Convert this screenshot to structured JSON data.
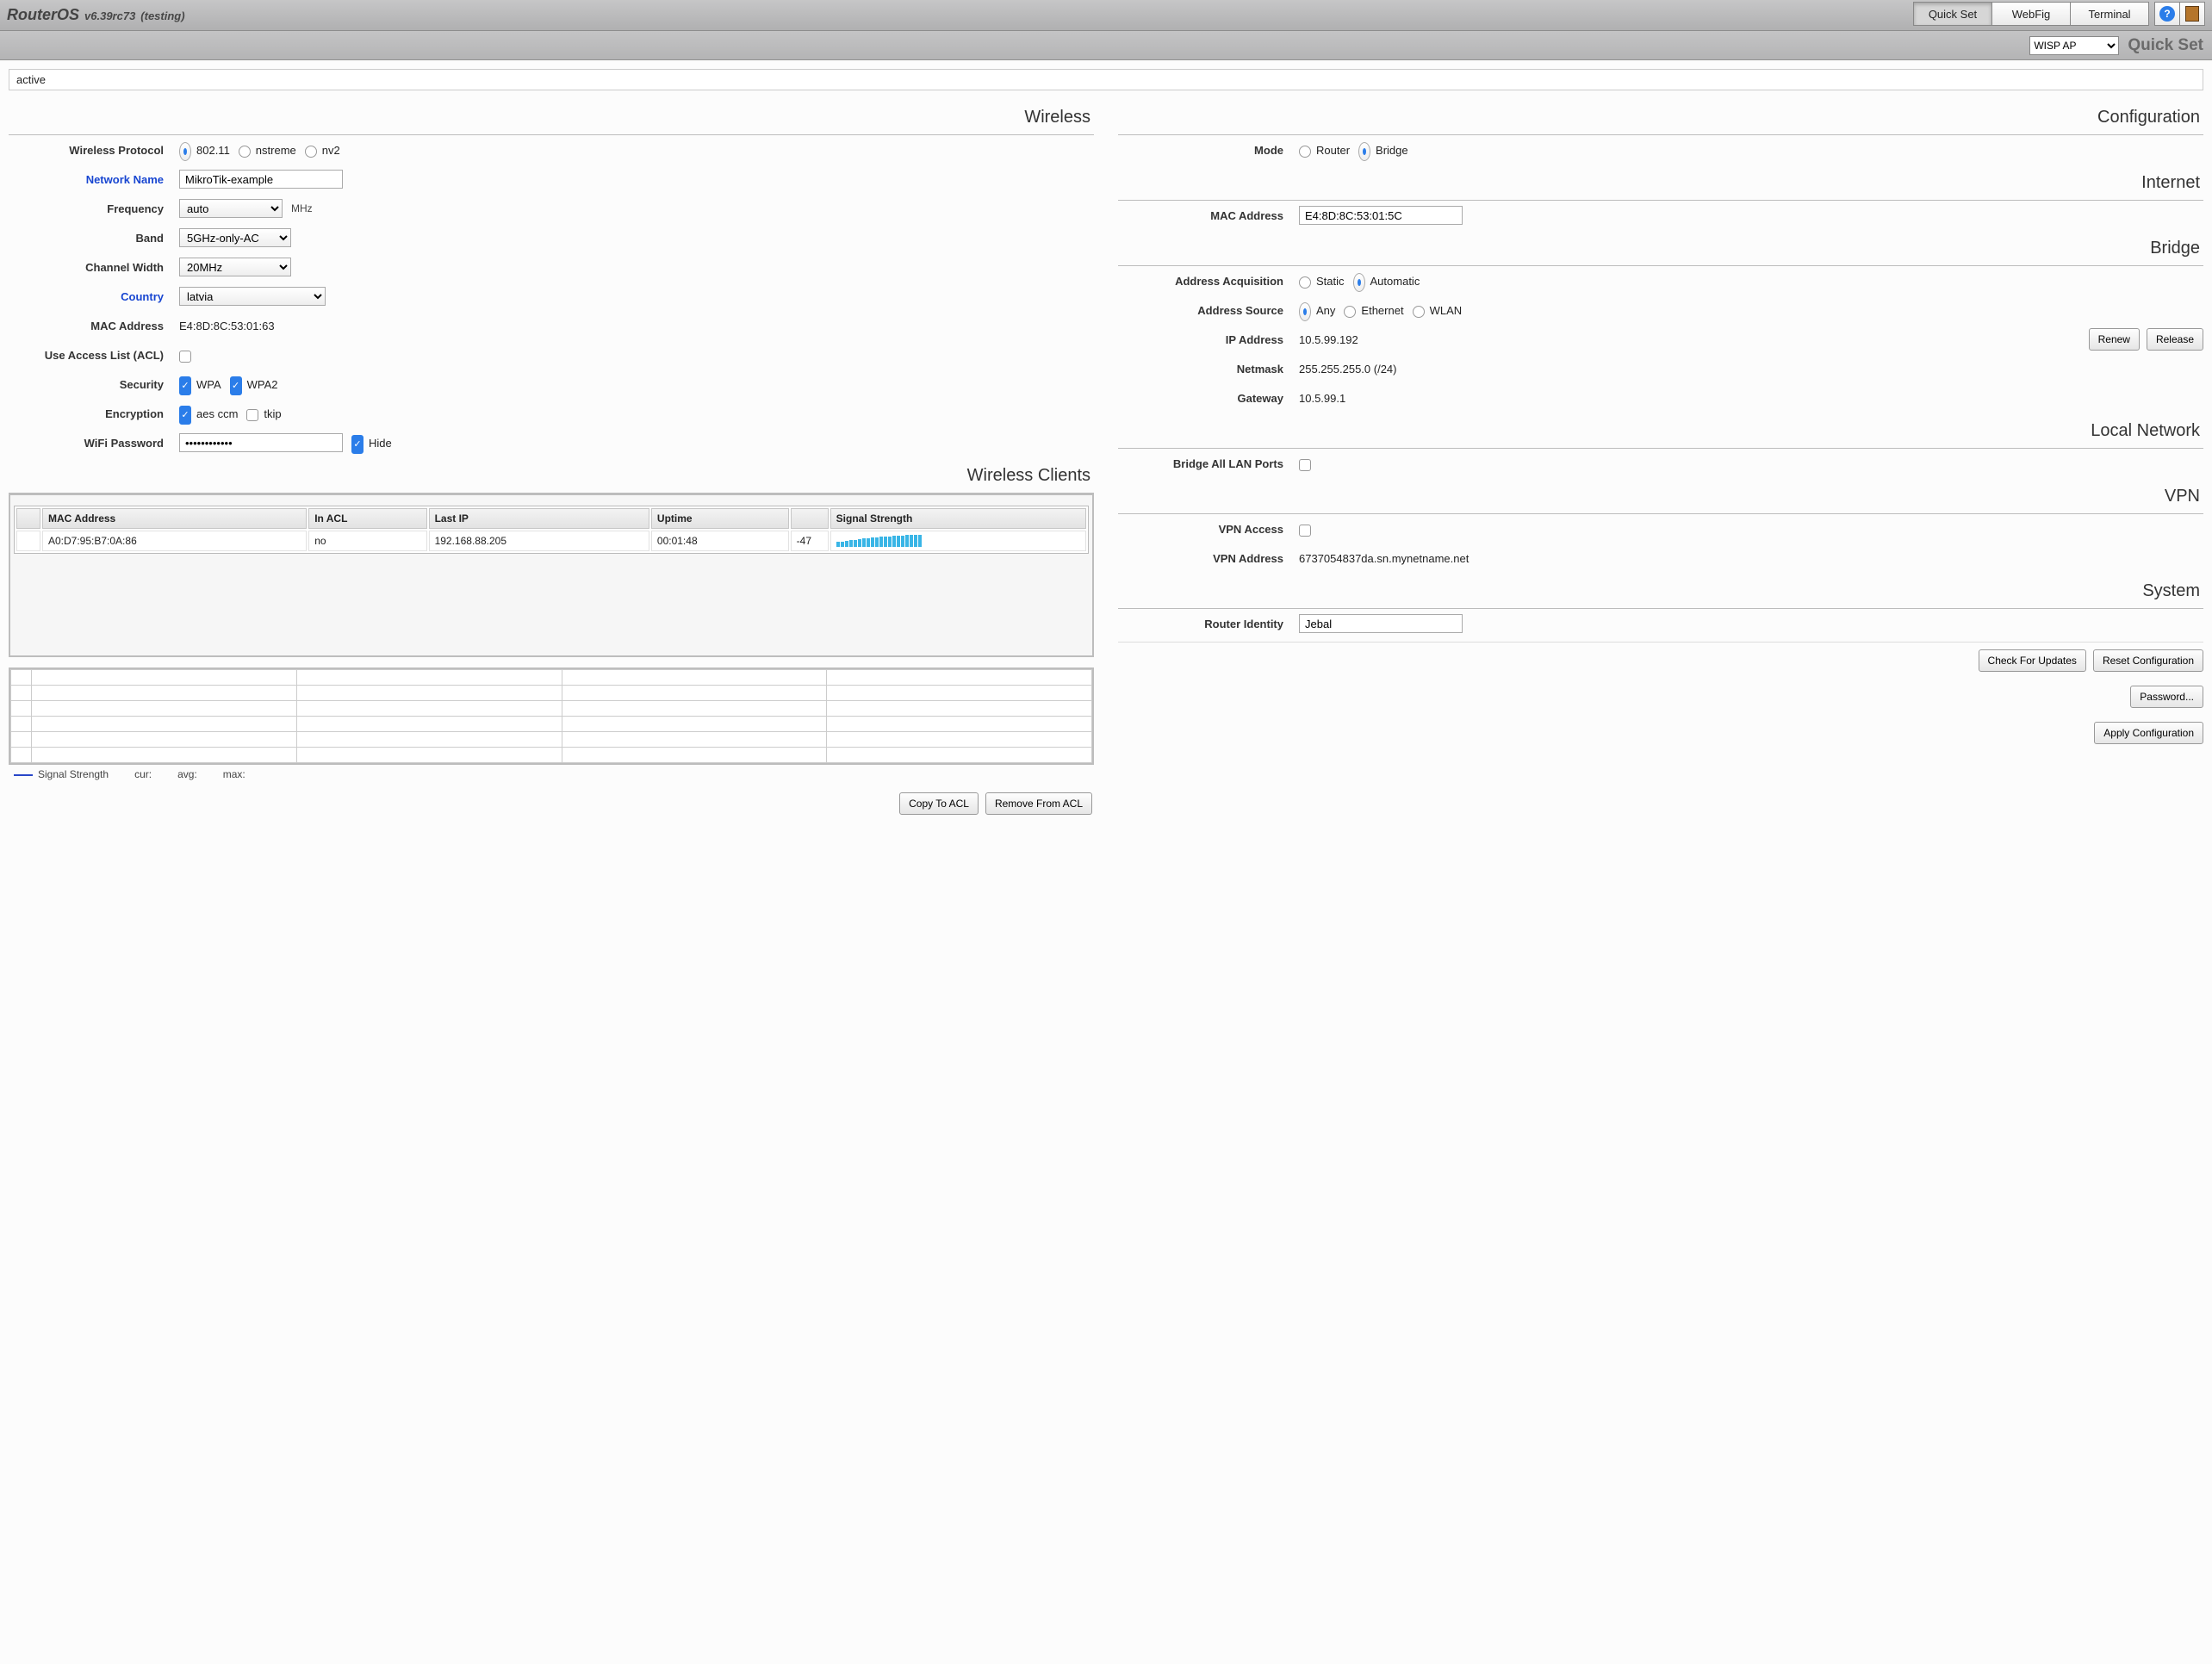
{
  "header": {
    "brand": "RouterOS",
    "version": "v6.39rc73",
    "testing": "(testing)",
    "tabs": {
      "quickset": "Quick Set",
      "webfig": "WebFig",
      "terminal": "Terminal"
    }
  },
  "subheader": {
    "mode_select": "WISP AP",
    "title": "Quick Set"
  },
  "status": "active",
  "wireless": {
    "title": "Wireless",
    "protocol_label": "Wireless Protocol",
    "protocol_opts": {
      "a": "802.11",
      "b": "nstreme",
      "c": "nv2"
    },
    "network_name_label": "Network Name",
    "network_name": "MikroTik-example",
    "frequency_label": "Frequency",
    "frequency": "auto",
    "frequency_unit": "MHz",
    "band_label": "Band",
    "band": "5GHz-only-AC",
    "chwidth_label": "Channel Width",
    "chwidth": "20MHz",
    "country_label": "Country",
    "country": "latvia",
    "mac_label": "MAC Address",
    "mac": "E4:8D:8C:53:01:63",
    "acl_label": "Use Access List (ACL)",
    "sec_label": "Security",
    "sec_wpa": "WPA",
    "sec_wpa2": "WPA2",
    "enc_label": "Encryption",
    "enc_aes": "aes ccm",
    "enc_tkip": "tkip",
    "pwd_label": "WiFi Password",
    "pwd_value": "••••••••••••",
    "pwd_hide": "Hide"
  },
  "clients": {
    "title": "Wireless Clients",
    "cols": {
      "mac": "MAC Address",
      "acl": "In ACL",
      "ip": "Last IP",
      "up": "Uptime",
      "sig": "Signal Strength"
    },
    "row": {
      "mac": "A0:D7:95:B7:0A:86",
      "acl": "no",
      "ip": "192.168.88.205",
      "up": "00:01:48",
      "sigtxt": "-47"
    },
    "legend_sig": "Signal Strength",
    "legend_cur": "cur:",
    "legend_avg": "avg:",
    "legend_max": "max:",
    "btn_copy": "Copy To ACL",
    "btn_remove": "Remove From ACL"
  },
  "config": {
    "title": "Configuration",
    "mode_label": "Mode",
    "mode_router": "Router",
    "mode_bridge": "Bridge"
  },
  "internet": {
    "title": "Internet",
    "mac_label": "MAC Address",
    "mac": "E4:8D:8C:53:01:5C"
  },
  "bridge": {
    "title": "Bridge",
    "acq_label": "Address Acquisition",
    "acq_static": "Static",
    "acq_auto": "Automatic",
    "src_label": "Address Source",
    "src_any": "Any",
    "src_eth": "Ethernet",
    "src_wlan": "WLAN",
    "ip_label": "IP Address",
    "ip": "10.5.99.192",
    "nm_label": "Netmask",
    "nm": "255.255.255.0 (/24)",
    "gw_label": "Gateway",
    "gw": "10.5.99.1",
    "btn_renew": "Renew",
    "btn_release": "Release"
  },
  "lan": {
    "title": "Local Network",
    "bridge_all_label": "Bridge All LAN Ports"
  },
  "vpn": {
    "title": "VPN",
    "access_label": "VPN Access",
    "addr_label": "VPN Address",
    "addr": "6737054837da.sn.mynetname.net"
  },
  "system": {
    "title": "System",
    "identity_label": "Router Identity",
    "identity": "Jebal",
    "btn_check": "Check For Updates",
    "btn_reset": "Reset Configuration",
    "btn_pwd": "Password...",
    "btn_apply": "Apply Configuration"
  }
}
